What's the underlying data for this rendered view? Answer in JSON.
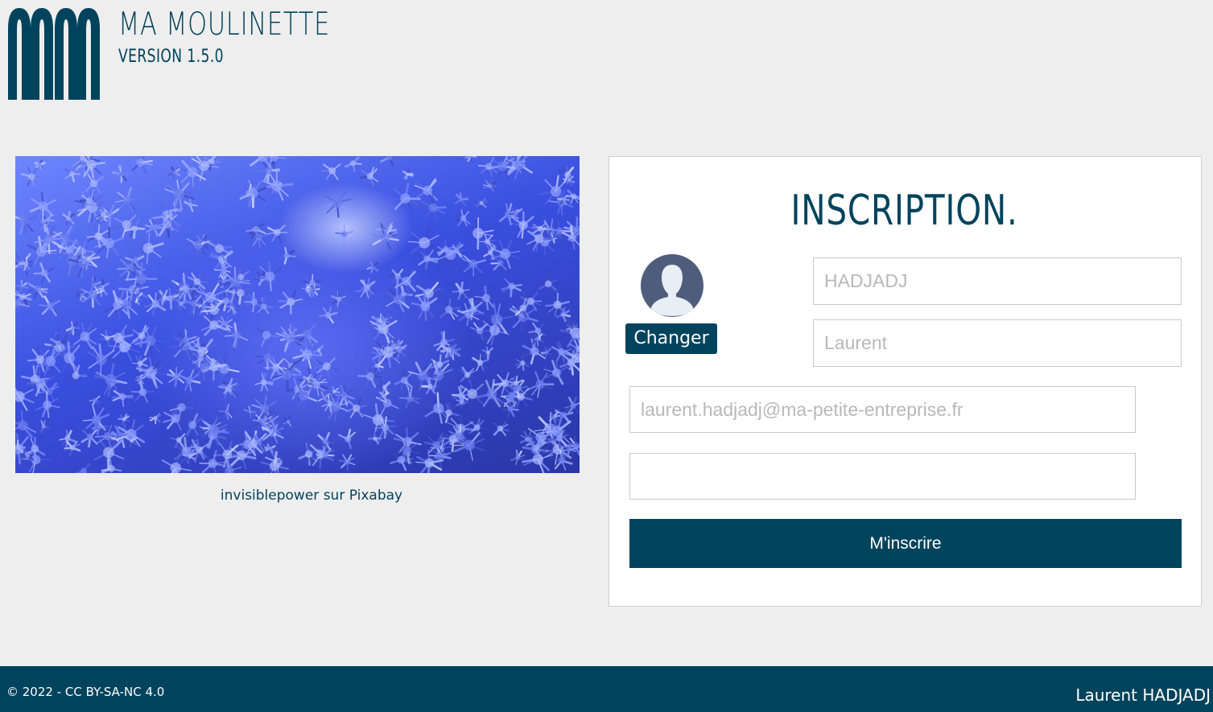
{
  "header": {
    "app_title": "MA MOULINETTE",
    "version": "VERSION 1.5.0",
    "logo_icon": "mm-logo-icon"
  },
  "photo": {
    "credit_author": "invisiblepower",
    "credit_sep": " sur ",
    "credit_source": "Pixabay"
  },
  "form": {
    "title": "INSCRIPTION.",
    "avatar_icon": "user-avatar-icon",
    "change_label": "Changer",
    "lastname_placeholder": "HADJADJ",
    "firstname_placeholder": "Laurent",
    "email_placeholder": "laurent.hadjadj@ma-petite-entreprise.fr",
    "password_value": "",
    "submit_label": "M'inscrire"
  },
  "footer": {
    "license": "© 2022 - CC BY-SA-NC 4.0",
    "author": "Laurent HADJADJ"
  },
  "colors": {
    "brand": "#00435c",
    "background": "#eeeeee"
  }
}
